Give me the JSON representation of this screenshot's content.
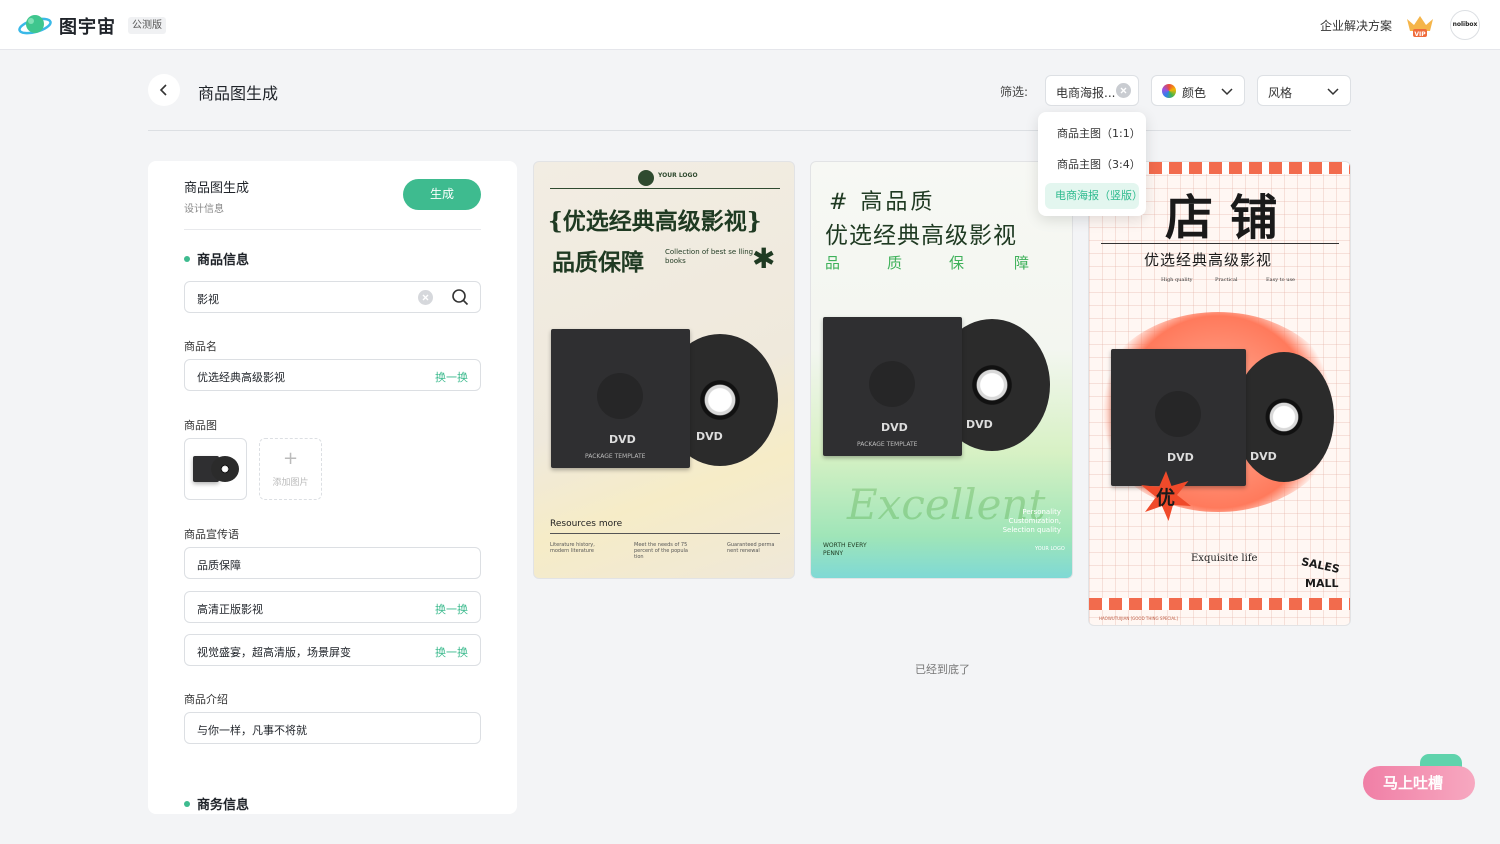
{
  "topbar": {
    "logo_text": "图宇宙",
    "beta_badge": "公测版",
    "enterprise_link": "企业解决方案",
    "vip_label": "VIP",
    "avatar_text": "nolibox"
  },
  "header": {
    "title": "商品图生成",
    "filter_label": "筛选:",
    "filter_type_value": "电商海报...",
    "filter_color_label": "颜色",
    "filter_style_label": "风格"
  },
  "dropdown": {
    "options": [
      "商品主图（1:1）",
      "商品主图（3:4）",
      "电商海报（竖版）"
    ],
    "selected_index": 2
  },
  "panel": {
    "title": "商品图生成",
    "subtitle": "设计信息",
    "generate_label": "生成",
    "section_product_info": "商品信息",
    "search_value": "影视",
    "name_label": "商品名",
    "name_value": "优选经典高级影视",
    "swap_label": "换一换",
    "image_label": "商品图",
    "add_image_label": "添加图片",
    "slogan_label": "商品宣传语",
    "slogans": [
      "品质保障",
      "高清正版影视",
      "视觉盛宴，超高清版，场景屏变"
    ],
    "intro_label": "商品介绍",
    "intro_value": "与你一样，凡事不将就",
    "section_business": "商务信息"
  },
  "posters": {
    "p1": {
      "logo": "YOUR LOGO",
      "headline": "{优选经典高级影视}",
      "sub": "品质保障",
      "sub_en": "Collection of best se lling books",
      "case_brand": "DVD",
      "case_caption": "PACKAGE  TEMPLATE",
      "disc_brand": "DVD",
      "footer_title": "Resources more",
      "footer_cols": [
        "Literature history, modern literature",
        "Meet the needs of 75 percent of the popula tion",
        "Guaranteed perma nent renewal"
      ]
    },
    "p2": {
      "headline1": "# 高品质",
      "headline2": "优选经典高级影视",
      "chars": [
        "品",
        "质",
        "保",
        "障"
      ],
      "case_brand": "DVD",
      "case_caption": "PACKAGE  TEMPLATE",
      "disc_brand": "DVD",
      "script": "Excellent",
      "features": "Personality Customization, Selection quality",
      "worth": "WORTH EVERY PENNY",
      "logo": "YOUR LOGO"
    },
    "p3": {
      "title": "店 铺",
      "subtitle": "优选经典高级影视",
      "tags": [
        "High quality",
        "Practical",
        "Easy to use"
      ],
      "badge": "优",
      "case_brand": "DVD",
      "disc_brand": "DVD",
      "tagline": "Exquisite life",
      "sales": "SALES",
      "mall": "MALL",
      "footer": "HAOWUTUIJIAN   [GOOD THING SPECIAL]"
    }
  },
  "bottom_text": "已经到底了",
  "feedback_label": "马上吐槽",
  "colors": {
    "accent": "#3ebb8f",
    "feedback": "#f07fa6"
  }
}
